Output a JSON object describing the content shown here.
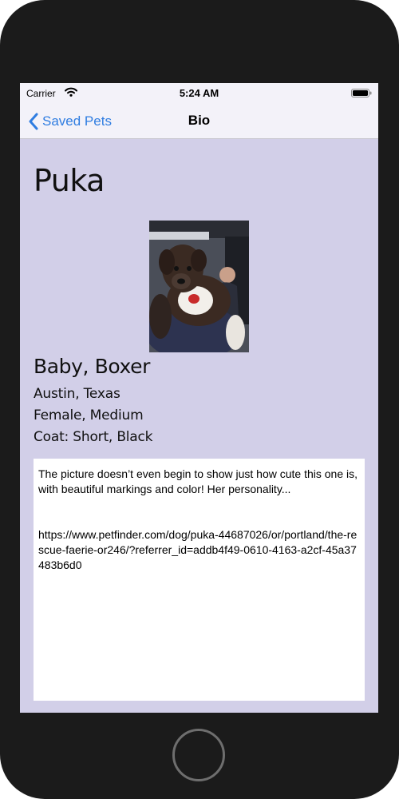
{
  "status_bar": {
    "carrier": "Carrier",
    "time": "5:24 AM"
  },
  "nav": {
    "back_label": "Saved Pets",
    "title": "Bio",
    "accent_color": "#2f7de1"
  },
  "pet": {
    "name": "Puka",
    "summary": "Baby, Boxer",
    "location": "Austin, Texas",
    "gender_size": "Female, Medium",
    "coat": "Coat: Short, Black",
    "description": "The picture doesn’t even begin to show just how cute this one is, with beautiful markings and color! Her personality...\n\n\nhttps://www.petfinder.com/dog/puka-44687026/or/portland/the-rescue-faerie-or246/?referrer_id=addb4f49-0610-4163-a2cf-45a37483b6d0"
  },
  "colors": {
    "screen_background": "#d2cfe8",
    "bar_background": "#f3f2f9"
  },
  "icons": {
    "wifi": "wifi-icon",
    "battery": "battery-icon",
    "back": "chevron-left-icon"
  }
}
